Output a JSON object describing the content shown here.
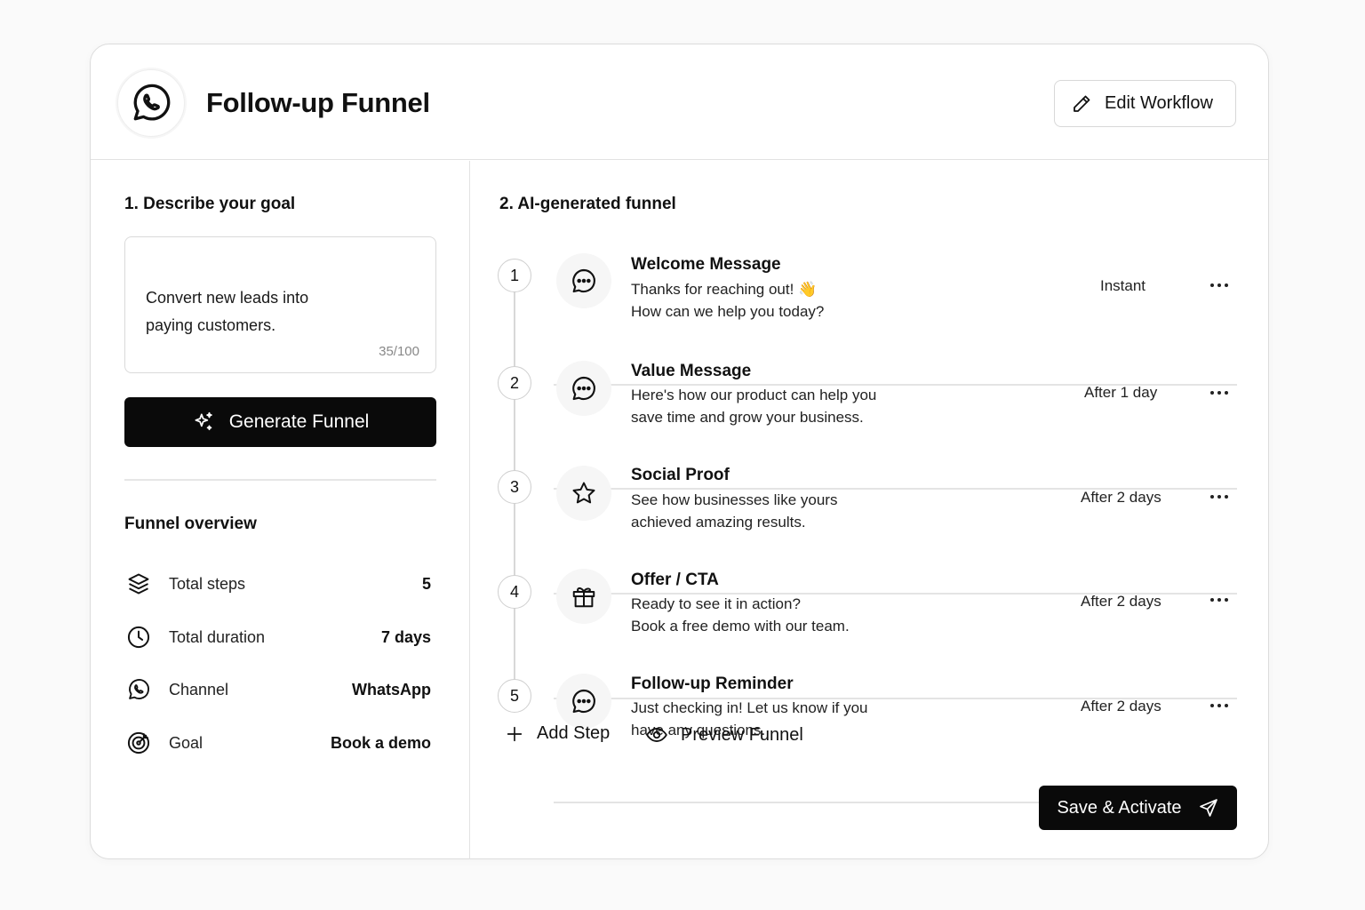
{
  "header": {
    "title": "Follow-up Funnel",
    "edit_label": "Edit Workflow"
  },
  "goal_section": {
    "label": "1. Describe your goal",
    "goal_text": "Convert new leads into\npaying customers.",
    "char_count": "35/100",
    "generate_label": "Generate Funnel"
  },
  "overview": {
    "title": "Funnel overview",
    "rows": [
      {
        "label": "Total steps",
        "value": "5",
        "icon": "layers-icon"
      },
      {
        "label": "Total duration",
        "value": "7 days",
        "icon": "clock-icon"
      },
      {
        "label": "Channel",
        "value": "WhatsApp",
        "icon": "whatsapp-icon"
      },
      {
        "label": "Goal",
        "value": "Book a demo",
        "icon": "target-icon"
      }
    ]
  },
  "funnel": {
    "label": "2.  AI-generated funnel",
    "steps": [
      {
        "num": "1",
        "icon": "message-icon",
        "title": "Welcome Message",
        "line1": "Thanks for reaching out! 👋",
        "line2": "How can we help you today?",
        "delay": "Instant"
      },
      {
        "num": "2",
        "icon": "message-icon",
        "title": "Value Message",
        "line1": "Here's how our product can help you",
        "line2": "save time and grow your business.",
        "delay": "After 1 day"
      },
      {
        "num": "3",
        "icon": "star-icon",
        "title": "Social Proof",
        "line1": "See how businesses like yours",
        "line2": "achieved amazing results.",
        "delay": "After 2 days"
      },
      {
        "num": "4",
        "icon": "gift-icon",
        "title": "Offer / CTA",
        "line1": "Ready to see it in action?",
        "line2": "Book a free demo with our team.",
        "delay": "After 2 days"
      },
      {
        "num": "5",
        "icon": "message-icon",
        "title": "Follow-up Reminder",
        "line1": "Just checking in! Let us know if you",
        "line2": "have any questions.",
        "delay": "After 2 days"
      }
    ]
  },
  "actions": {
    "add_step": "Add Step",
    "preview": "Preview Funnel",
    "save": "Save & Activate"
  }
}
